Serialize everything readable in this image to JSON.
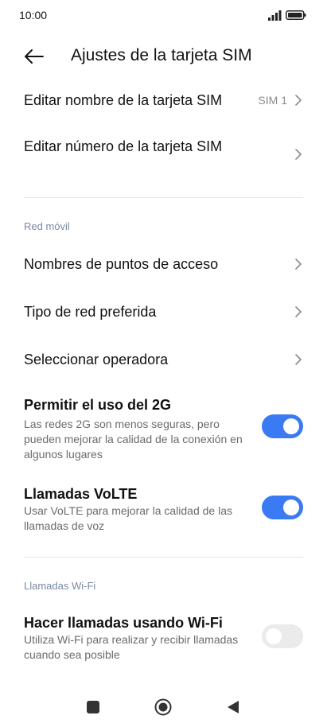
{
  "status_bar": {
    "time": "10:00",
    "icons": [
      "signal-icon",
      "battery-icon"
    ]
  },
  "header": {
    "title": "Ajustes de la tarjeta SIM",
    "back_icon": "arrow-left-icon"
  },
  "rows": {
    "edit_name": {
      "title": "Editar nombre de la tarjeta SIM",
      "value": "SIM 1"
    },
    "edit_number": {
      "title": "Editar número de la tarjeta SIM"
    },
    "apn": {
      "title": "Nombres de puntos de acceso"
    },
    "network_type": {
      "title": "Tipo de red preferida"
    },
    "operator": {
      "title": "Seleccionar operadora"
    }
  },
  "sections": {
    "mobile_network": "Red móvil",
    "wifi_calls": "Llamadas Wi-Fi"
  },
  "toggles": {
    "allow_2g": {
      "title": "Permitir el uso del 2G",
      "description": "Las redes 2G son menos seguras, pero pueden mejorar la calidad de la conexión en algunos lugares",
      "state": "on"
    },
    "volte": {
      "title": "Llamadas VoLTE",
      "description": "Usar VoLTE para mejorar la calidad de las llamadas de voz",
      "state": "on"
    },
    "wifi_calling": {
      "title": "Hacer llamadas usando Wi-Fi",
      "description": "Utiliza Wi-Fi para realizar y recibir llamadas cuando sea posible",
      "state": "off"
    }
  },
  "colors": {
    "toggle_on": "#3a7bf3",
    "toggle_off": "#ebebeb",
    "section_header": "#7a8aa0"
  },
  "nav_bar": {
    "icons": [
      "recents-square-icon",
      "home-circle-icon",
      "back-triangle-icon"
    ]
  }
}
